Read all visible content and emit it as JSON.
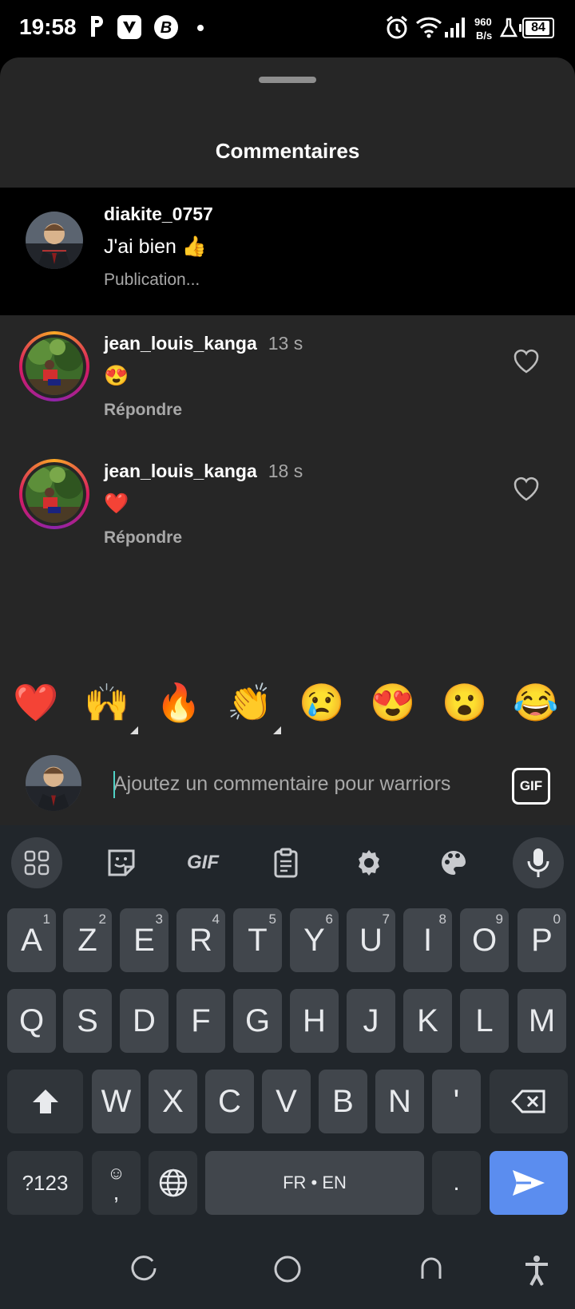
{
  "status_bar": {
    "time": "19:58",
    "network_speed_value": "960",
    "network_speed_unit": "B/s",
    "battery": "84"
  },
  "sheet": {
    "title": "Commentaires"
  },
  "caption": {
    "username": "diakite_0757",
    "text": "J'ai bien 👍",
    "meta": "Publication..."
  },
  "comments": [
    {
      "username": "jean_louis_kanga",
      "time": "13 s",
      "text": "😍",
      "reply": "Répondre"
    },
    {
      "username": "jean_louis_kanga",
      "time": "18 s",
      "text": "❤️",
      "reply": "Répondre"
    }
  ],
  "quick_reactions": [
    "❤️",
    "🙌",
    "🔥",
    "👏",
    "😢",
    "😍",
    "😮",
    "😂"
  ],
  "comment_input": {
    "placeholder": "Ajoutez un commentaire pour warriors",
    "gif_label": "GIF"
  },
  "keyboard": {
    "toolbar": [
      "apps-grid-icon",
      "sticker-icon",
      "gif-icon",
      "clipboard-icon",
      "settings-gear-icon",
      "theme-palette-icon",
      "microphone-icon"
    ],
    "toolbar_gif_label": "GIF",
    "row1": [
      {
        "k": "A",
        "h": "1"
      },
      {
        "k": "Z",
        "h": "2"
      },
      {
        "k": "E",
        "h": "3"
      },
      {
        "k": "R",
        "h": "4"
      },
      {
        "k": "T",
        "h": "5"
      },
      {
        "k": "Y",
        "h": "6"
      },
      {
        "k": "U",
        "h": "7"
      },
      {
        "k": "I",
        "h": "8"
      },
      {
        "k": "O",
        "h": "9"
      },
      {
        "k": "P",
        "h": "0"
      }
    ],
    "row2": [
      "Q",
      "S",
      "D",
      "F",
      "G",
      "H",
      "J",
      "K",
      "L",
      "M"
    ],
    "row3": [
      "W",
      "X",
      "C",
      "V",
      "B",
      "N",
      "'"
    ],
    "symbols_label": "?123",
    "comma_label": ",",
    "period_label": ".",
    "space_label": "FR • EN"
  },
  "colors": {
    "sheet_bg": "#262626",
    "caption_bg": "#000000",
    "keyboard_bg": "#21262b",
    "key_bg": "#41464c",
    "enter_key": "#5b8def",
    "story_ring": [
      "#f9a825",
      "#d81b60",
      "#8e24aa"
    ]
  }
}
